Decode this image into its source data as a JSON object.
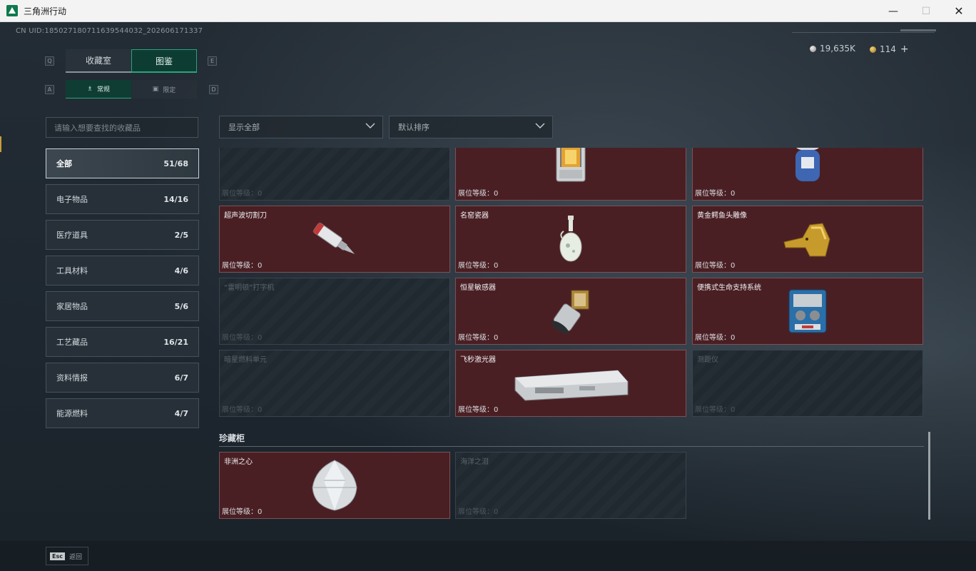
{
  "window": {
    "title": "三角洲行动",
    "min": "—",
    "max": "☐",
    "close": "✕"
  },
  "header": {
    "uid": "CN UID:1850271807116395440​32_202606171337",
    "currency_a": "19,635K",
    "currency_b": "114",
    "plus": "+"
  },
  "keys": {
    "left_tab": "Q",
    "right_tab": "E",
    "left_sub": "A",
    "right_sub": "D"
  },
  "tabs": [
    {
      "label": "收藏室"
    },
    {
      "label": "图鉴"
    }
  ],
  "subtabs": [
    {
      "label": "常规",
      "icon": "♗"
    },
    {
      "label": "限定",
      "icon": "▣"
    }
  ],
  "search": {
    "placeholder": "请输入想要查找的收藏品"
  },
  "categories": [
    {
      "label": "全部",
      "count": "51/68"
    },
    {
      "label": "电子物品",
      "count": "14/16"
    },
    {
      "label": "医疗道具",
      "count": "2/5"
    },
    {
      "label": "工具材料",
      "count": "4/6"
    },
    {
      "label": "家居物品",
      "count": "5/6"
    },
    {
      "label": "工艺藏品",
      "count": "16/21"
    },
    {
      "label": "资料情报",
      "count": "6/7"
    },
    {
      "label": "能源燃料",
      "count": "4/7"
    }
  ],
  "filters": {
    "show": "显示全部",
    "sort": "默认排序"
  },
  "grid": {
    "level_label": "展位等级：0",
    "cards": [
      {
        "name": "",
        "owned": false,
        "icon": "blank"
      },
      {
        "name": "",
        "owned": true,
        "icon": "lantern-icon"
      },
      {
        "name": "",
        "owned": true,
        "icon": "gas-canister-icon"
      },
      {
        "name": "超声波切割刀",
        "owned": true,
        "icon": "ultrasonic-knife-icon"
      },
      {
        "name": "名窑瓷器",
        "owned": true,
        "icon": "porcelain-vase-icon"
      },
      {
        "name": "黄金鳄鱼头雕像",
        "owned": true,
        "icon": "gold-crocodile-icon"
      },
      {
        "name": "“雷明顿”打字机",
        "owned": false,
        "icon": "typewriter-icon"
      },
      {
        "name": "恒星敏感器",
        "owned": true,
        "icon": "star-sensor-icon"
      },
      {
        "name": "便携式生命支持系统",
        "owned": true,
        "icon": "life-support-icon"
      },
      {
        "name": "暗星燃料单元",
        "owned": false,
        "icon": "fuel-cell-icon"
      },
      {
        "name": "飞秒激光器",
        "owned": true,
        "icon": "femtosecond-laser-icon"
      },
      {
        "name": "测距仪",
        "owned": false,
        "icon": "rangefinder-icon"
      }
    ]
  },
  "section": {
    "title": "珍藏柜",
    "cards": [
      {
        "name": "非洲之心",
        "owned": true,
        "icon": "diamond-icon"
      },
      {
        "name": "海洋之泪",
        "owned": false,
        "icon": "gem-icon"
      }
    ]
  },
  "footer": {
    "esc_key": "Esc",
    "back": "返回"
  }
}
